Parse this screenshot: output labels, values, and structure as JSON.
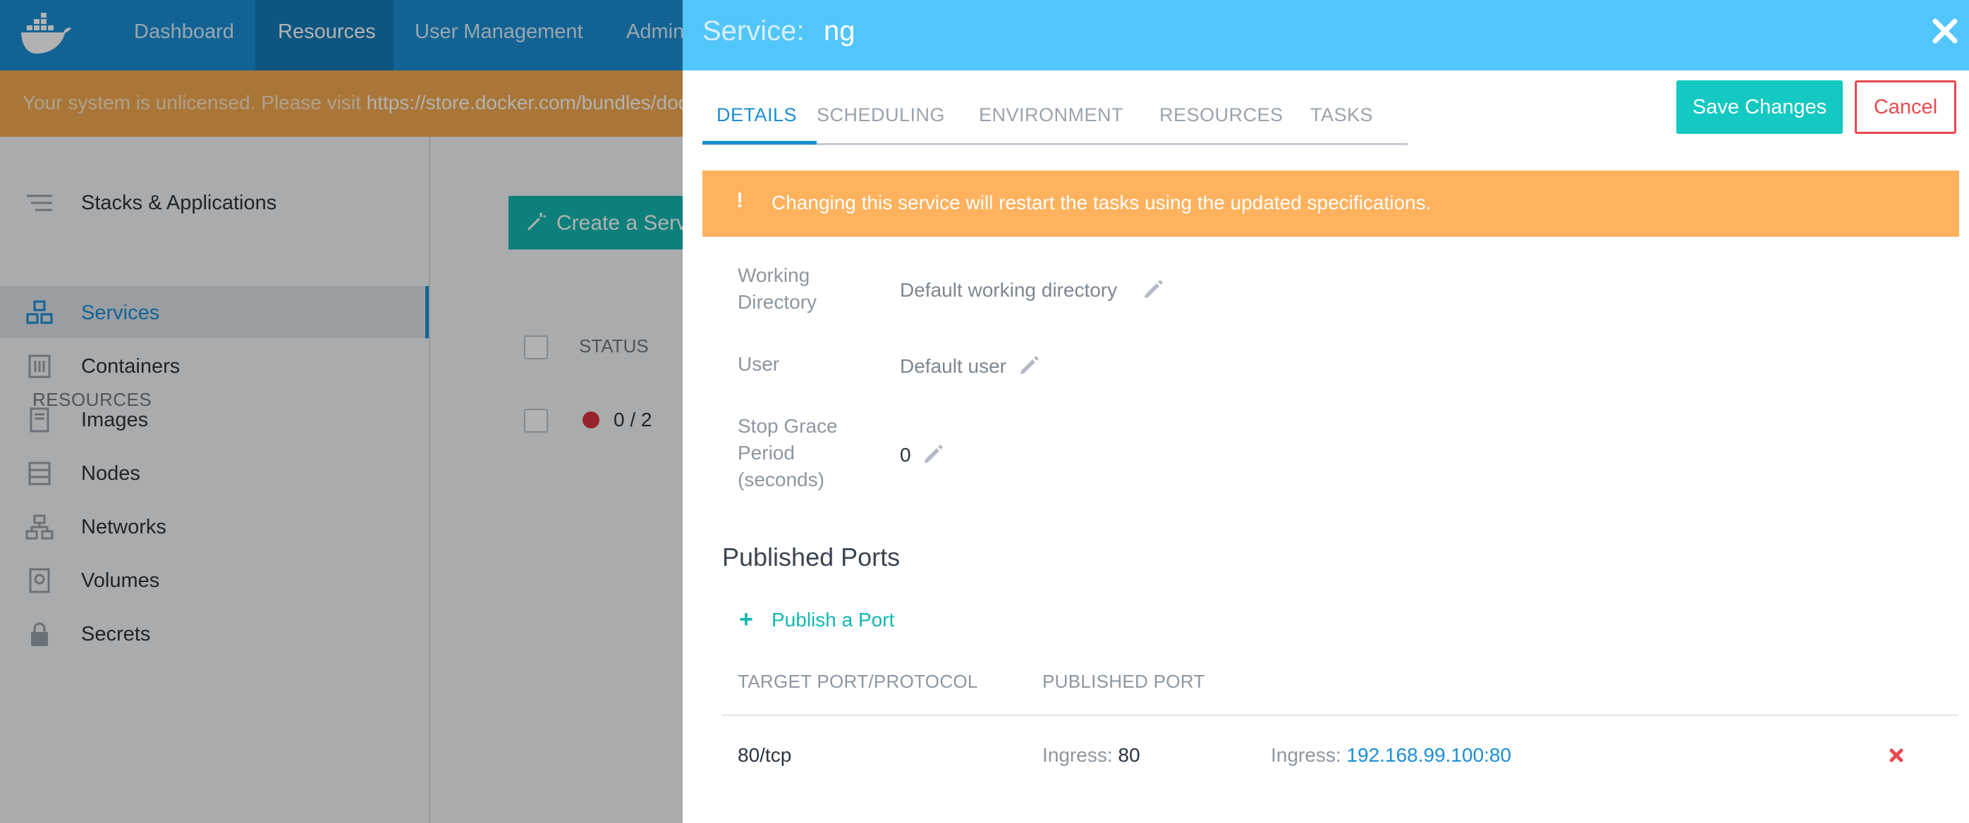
{
  "topnav": {
    "items": [
      {
        "label": "Dashboard"
      },
      {
        "label": "Resources"
      },
      {
        "label": "User Management"
      },
      {
        "label": "Admin"
      }
    ]
  },
  "banner": {
    "text": "Your system is unlicensed. Please visit ",
    "link": "https://store.docker.com/bundles/docker-datacenter"
  },
  "sidebar": {
    "top_item": "Stacks & Applications",
    "section_label": "RESOURCES",
    "items": [
      {
        "label": "Services",
        "icon": "services-icon",
        "active": true
      },
      {
        "label": "Containers",
        "icon": "containers-icon"
      },
      {
        "label": "Images",
        "icon": "images-icon"
      },
      {
        "label": "Nodes",
        "icon": "nodes-icon"
      },
      {
        "label": "Networks",
        "icon": "networks-icon"
      },
      {
        "label": "Volumes",
        "icon": "volumes-icon"
      },
      {
        "label": "Secrets",
        "icon": "lock-icon"
      }
    ]
  },
  "content": {
    "create_button": "Create a Service",
    "status_header": "STATUS",
    "status_value": "0 / 2",
    "status_color": "#d9333f"
  },
  "panel": {
    "title_label": "Service:",
    "title_name": "ng",
    "tabs": [
      {
        "label": "DETAILS",
        "active": true
      },
      {
        "label": "SCHEDULING"
      },
      {
        "label": "ENVIRONMENT"
      },
      {
        "label": "RESOURCES"
      },
      {
        "label": "TASKS"
      }
    ],
    "save_label": "Save Changes",
    "cancel_label": "Cancel",
    "warning": {
      "icon": "!",
      "message": "Changing this service will restart the tasks using the updated specifications."
    },
    "fields": {
      "working_directory": {
        "label": "Working Directory",
        "value": "Default working directory"
      },
      "user": {
        "label": "User",
        "value": "Default user"
      },
      "stop_grace": {
        "label": "Stop Grace Period (seconds)",
        "value": "0"
      }
    },
    "ports": {
      "title": "Published Ports",
      "publish_link": "Publish a Port",
      "col_target": "TARGET PORT/PROTOCOL",
      "col_published": "PUBLISHED PORT",
      "rows": [
        {
          "target": "80/tcp",
          "ingress_label": "Ingress:",
          "ingress_port": "80",
          "ingress_addr_label": "Ingress:",
          "ingress_addr": "192.168.99.100:80"
        }
      ]
    }
  },
  "colors": {
    "nav_blue": "#1b8fd4",
    "panel_header": "#52c6fb",
    "banner_orange": "#f2a94f",
    "warning_orange": "#ffb25e",
    "teal": "#13c9c1",
    "danger": "#e8494f"
  }
}
